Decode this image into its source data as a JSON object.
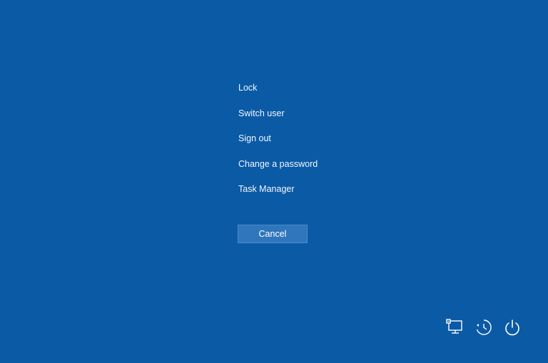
{
  "menu": {
    "items": [
      {
        "id": "lock",
        "label": "Lock"
      },
      {
        "id": "switch-user",
        "label": "Switch user"
      },
      {
        "id": "sign-out",
        "label": "Sign out"
      },
      {
        "id": "change-password",
        "label": "Change a password"
      },
      {
        "id": "task-manager",
        "label": "Task Manager"
      }
    ],
    "cancel_label": "Cancel"
  },
  "tray": {
    "icons": [
      {
        "name": "network-icon"
      },
      {
        "name": "ease-of-access-icon"
      },
      {
        "name": "power-icon"
      }
    ]
  },
  "colors": {
    "background": "#0b5aa6",
    "button": "#2f76bd",
    "text": "#ffffff"
  }
}
